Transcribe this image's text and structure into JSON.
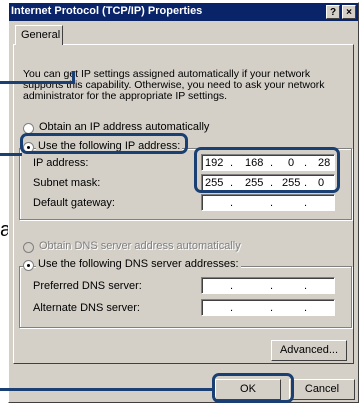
{
  "window": {
    "title": "Internet Protocol (TCP/IP) Properties",
    "help_glyph": "?",
    "close_glyph": "×"
  },
  "tabs": [
    {
      "label": "General"
    }
  ],
  "description": "You can get IP settings assigned automatically if your network supports this capability. Otherwise, you need to ask your network administrator for the appropriate IP settings.",
  "ip_section": {
    "obtain_auto_label": "Obtain an IP address automatically",
    "use_following_label": "Use the following IP address:",
    "selected": "use_following",
    "ip_address": {
      "label": "IP address:",
      "octets": [
        "192",
        "168",
        "0",
        "28"
      ]
    },
    "subnet_mask": {
      "label": "Subnet mask:",
      "octets": [
        "255",
        "255",
        "255",
        "0"
      ]
    },
    "default_gateway": {
      "label": "Default gateway:",
      "octets": [
        "",
        "",
        "",
        ""
      ]
    }
  },
  "dns_section": {
    "obtain_auto_label": "Obtain DNS server address automatically",
    "use_following_label": "Use the following DNS server addresses:",
    "selected": "use_following",
    "preferred": {
      "label": "Preferred DNS server:",
      "octets": [
        "",
        "",
        "",
        ""
      ]
    },
    "alternate": {
      "label": "Alternate DNS server:",
      "octets": [
        "",
        "",
        "",
        ""
      ]
    }
  },
  "buttons": {
    "advanced": "Advanced...",
    "ok": "OK",
    "cancel": "Cancel"
  },
  "colors": {
    "highlight": "#1a3f73",
    "titlebar": "#0a246a",
    "dialog_face": "#d4d0c8"
  },
  "stray_letter": "a"
}
